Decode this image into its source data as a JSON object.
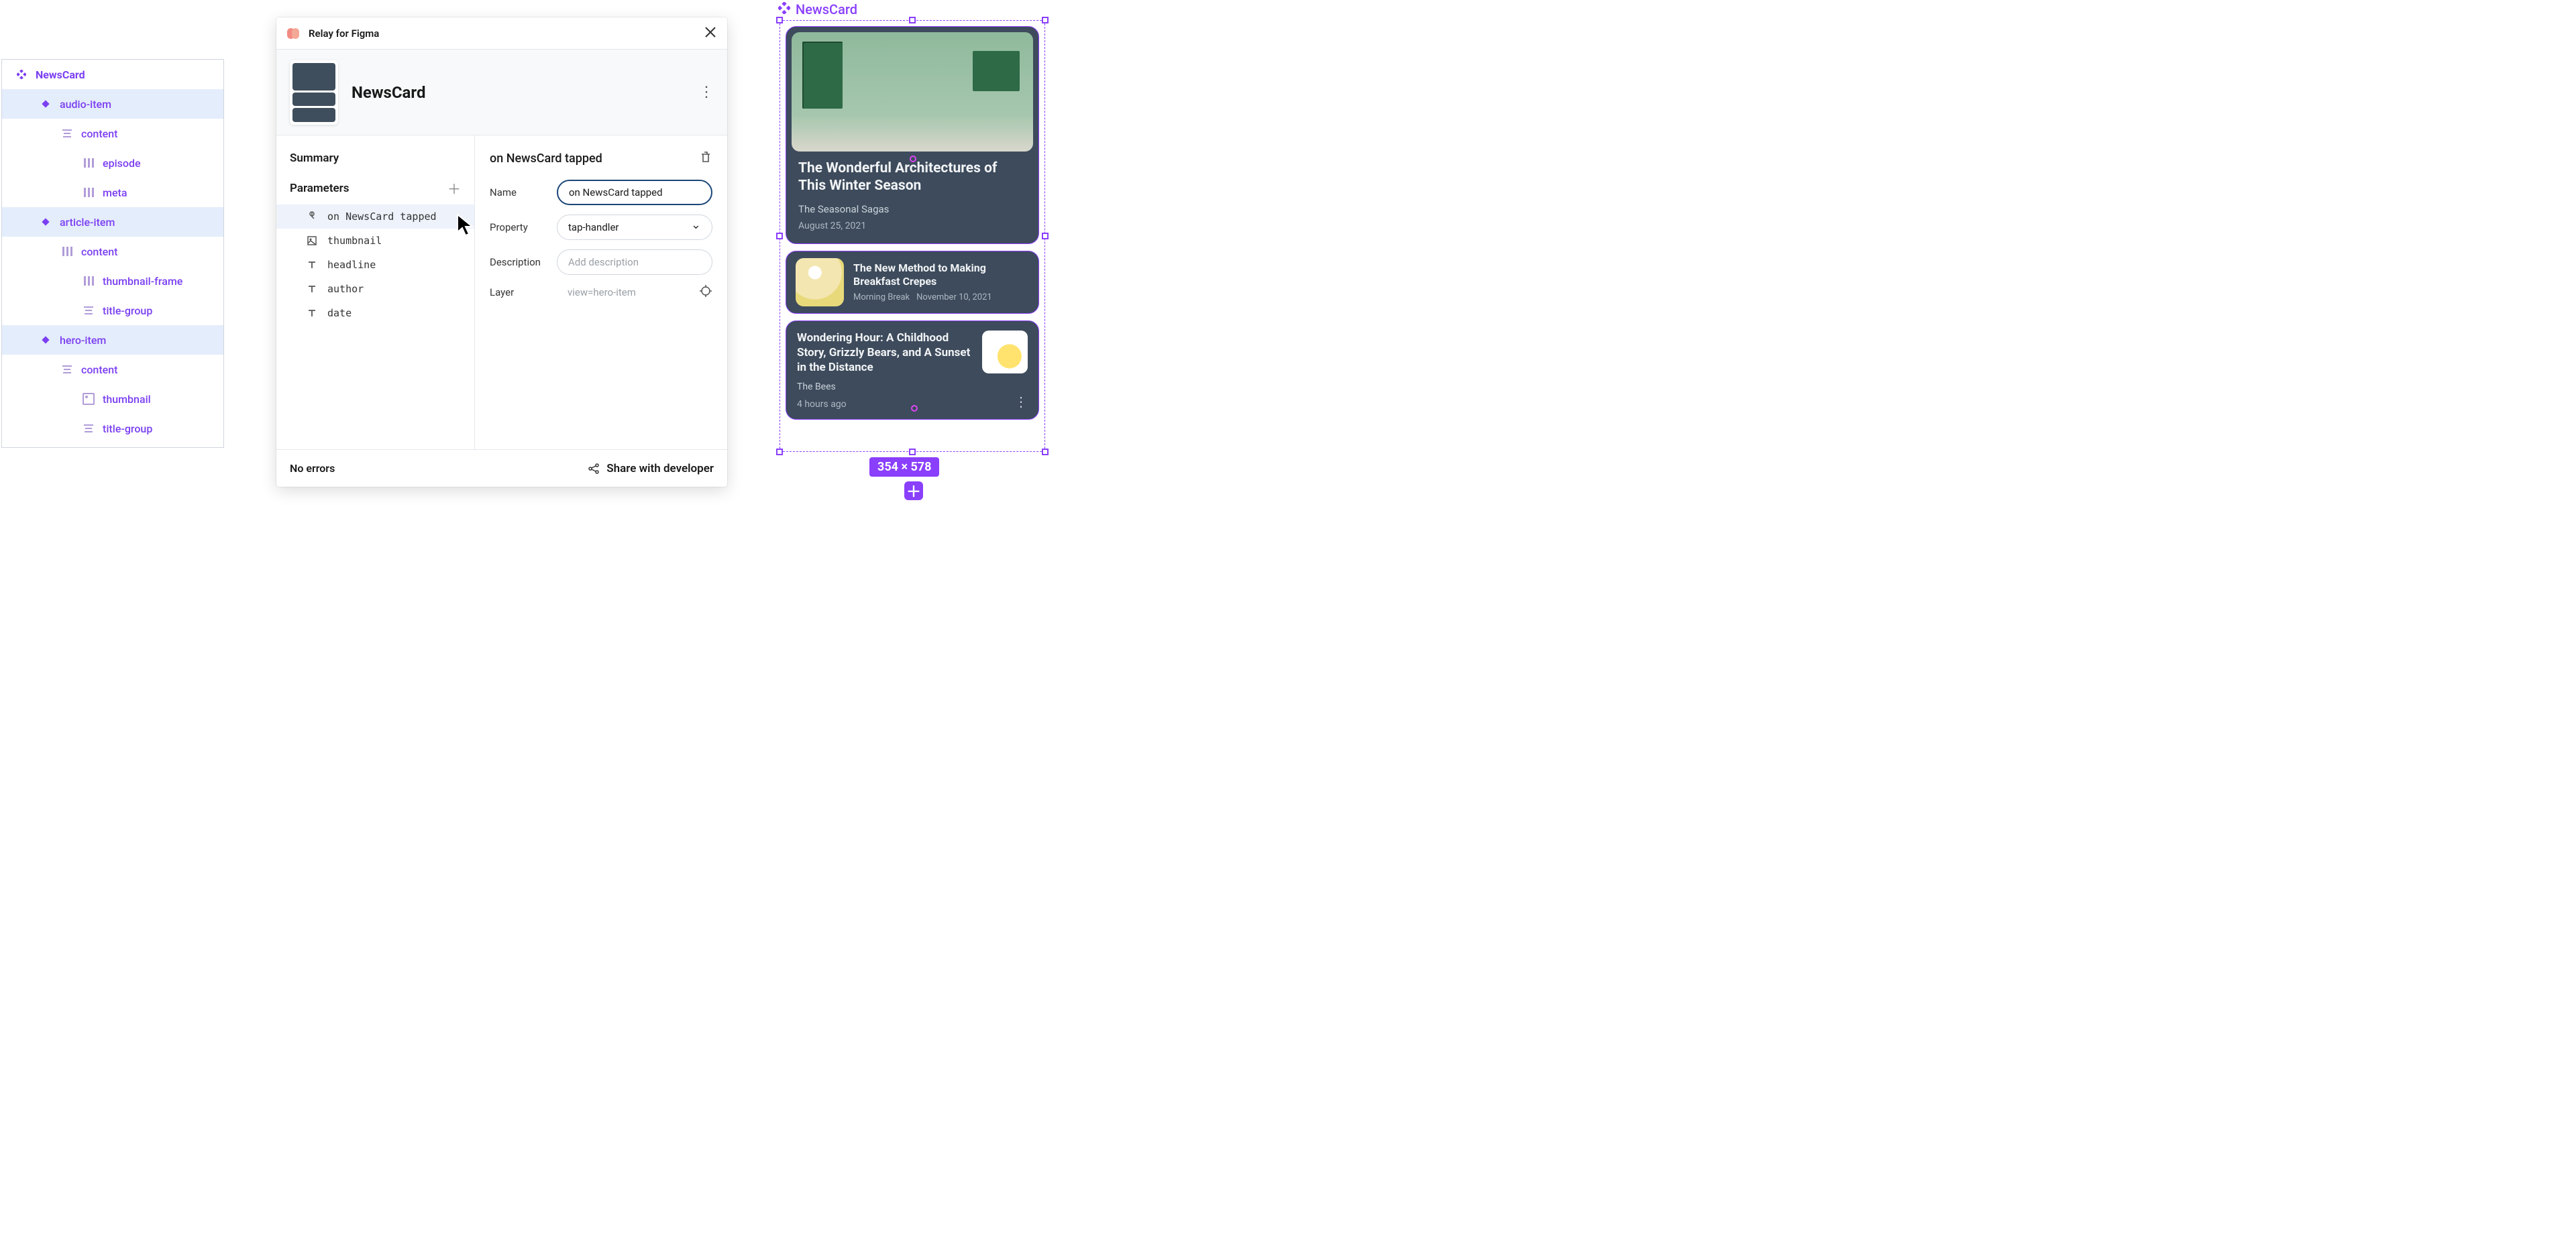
{
  "layers": {
    "root": "NewsCard",
    "items": [
      {
        "label": "audio-item",
        "depth": "d1",
        "icon": "diamond",
        "sel": true
      },
      {
        "label": "content",
        "depth": "d2",
        "icon": "lines",
        "sel": false
      },
      {
        "label": "episode",
        "depth": "d3",
        "icon": "bars",
        "sel": false
      },
      {
        "label": "meta",
        "depth": "d3",
        "icon": "bars",
        "sel": false
      },
      {
        "label": "article-item",
        "depth": "d1",
        "icon": "diamond",
        "sel": true
      },
      {
        "label": "content",
        "depth": "d2",
        "icon": "bars",
        "sel": false
      },
      {
        "label": "thumbnail-frame",
        "depth": "d3",
        "icon": "bars",
        "sel": false
      },
      {
        "label": "title-group",
        "depth": "d3",
        "icon": "lines",
        "sel": false
      },
      {
        "label": "hero-item",
        "depth": "d1",
        "icon": "diamond",
        "sel": true
      },
      {
        "label": "content",
        "depth": "d2",
        "icon": "lines",
        "sel": false
      },
      {
        "label": "thumbnail",
        "depth": "d3",
        "icon": "img",
        "sel": false
      },
      {
        "label": "title-group",
        "depth": "d3",
        "icon": "lines",
        "sel": false
      }
    ]
  },
  "plugin": {
    "title": "Relay for Figma",
    "component_name": "NewsCard",
    "left": {
      "summary": "Summary",
      "parameters": "Parameters",
      "params": [
        {
          "label": "on NewsCard tapped",
          "icon": "tap",
          "sel": true
        },
        {
          "label": "thumbnail",
          "icon": "image",
          "sel": false
        },
        {
          "label": "headline",
          "icon": "text",
          "sel": false
        },
        {
          "label": "author",
          "icon": "text",
          "sel": false
        },
        {
          "label": "date",
          "icon": "text",
          "sel": false
        }
      ]
    },
    "right": {
      "heading": "on NewsCard tapped",
      "name_label": "Name",
      "name_value": "on NewsCard tapped",
      "property_label": "Property",
      "property_value": "tap-handler",
      "description_label": "Description",
      "description_placeholder": "Add description",
      "layer_label": "Layer",
      "layer_value": "view=hero-item"
    },
    "footer": {
      "errors": "No errors",
      "share": "Share with developer"
    }
  },
  "canvas": {
    "label": "NewsCard",
    "hero": {
      "title": "The Wonderful Architectures of This Winter Season",
      "subtitle": "The Seasonal Sagas",
      "date": "August 25, 2021"
    },
    "article": {
      "title": "The New Method to Making Breakfast Crepes",
      "author": "Morning Break",
      "date": "November 10, 2021"
    },
    "audio": {
      "title": "Wondering Hour: A Childhood Story, Grizzly Bears, and A Sunset in the Distance",
      "author": "The Bees",
      "time": "4 hours ago"
    },
    "size": "354 × 578"
  }
}
